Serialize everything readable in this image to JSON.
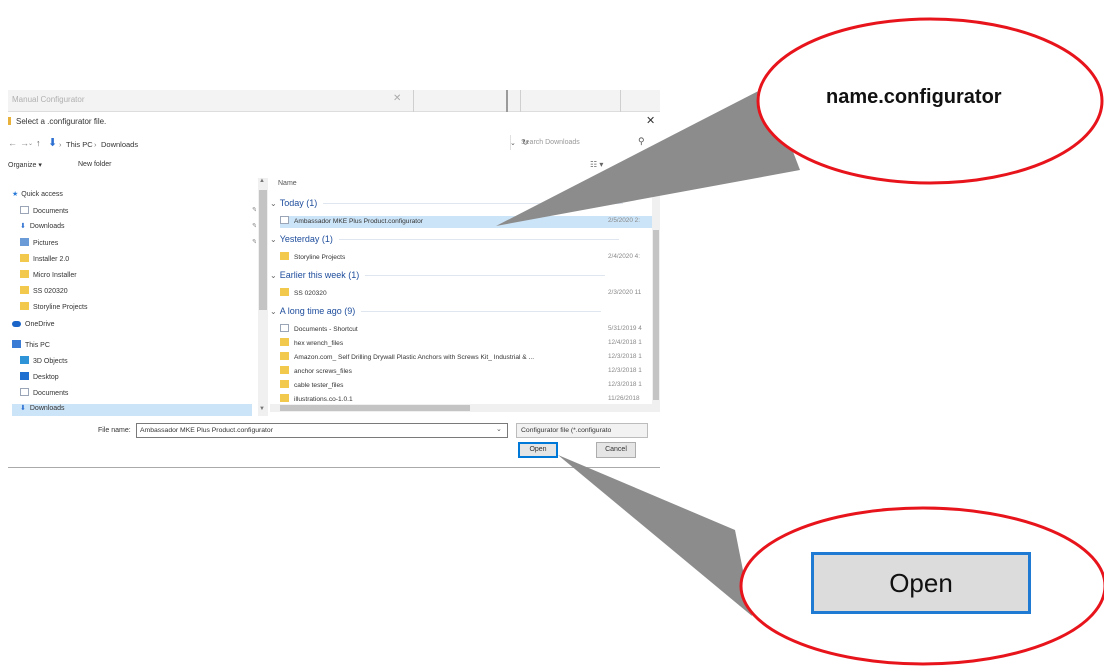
{
  "background_window": {
    "title": "Manual Configurator"
  },
  "dialog": {
    "title": "Select a .configurator file.",
    "address": {
      "crumbs": [
        "This PC",
        "Downloads"
      ],
      "search_placeholder": "Search Downloads"
    },
    "command_bar": {
      "organize": "Organize ▾",
      "new_folder": "New folder"
    },
    "nav_pane": {
      "items": [
        {
          "label": "Quick access",
          "icon": "star-icon"
        },
        {
          "label": "Documents",
          "icon": "documents-icon"
        },
        {
          "label": "Downloads",
          "icon": "download-arrow-icon"
        },
        {
          "label": "Pictures",
          "icon": "pictures-icon"
        },
        {
          "label": "Installer 2.0",
          "icon": "folder-icon"
        },
        {
          "label": "Micro Installer",
          "icon": "folder-icon"
        },
        {
          "label": "SS 020320",
          "icon": "folder-icon"
        },
        {
          "label": "Storyline Projects",
          "icon": "folder-icon"
        },
        {
          "label": "OneDrive",
          "icon": "cloud-icon"
        },
        {
          "label": "This PC",
          "icon": "pc-icon"
        },
        {
          "label": "3D Objects",
          "icon": "3d-objects-icon"
        },
        {
          "label": "Desktop",
          "icon": "desktop-icon"
        },
        {
          "label": "Documents",
          "icon": "documents-icon"
        },
        {
          "label": "Downloads",
          "icon": "download-arrow-icon"
        }
      ]
    },
    "file_pane": {
      "column_header": "Name",
      "groups": [
        {
          "label": "Today (1)"
        },
        {
          "label": "Yesterday (1)"
        },
        {
          "label": "Earlier this week (1)"
        },
        {
          "label": "A long time ago (9)"
        }
      ],
      "files": [
        {
          "name": "Ambassador MKE Plus Product.configurator",
          "date": "2/5/2020 2:",
          "selected": true
        },
        {
          "name": "Storyline Projects",
          "date": "2/4/2020 4:"
        },
        {
          "name": "SS 020320",
          "date": "2/3/2020 11"
        },
        {
          "name": "Documents - Shortcut",
          "date": "5/31/2019 4"
        },
        {
          "name": "hex wrench_files",
          "date": "12/4/2018 1"
        },
        {
          "name": "Amazon.com_ Self Drilling Drywall Plastic Anchors with Screws Kit_ Industrial & ...",
          "date": "12/3/2018 1"
        },
        {
          "name": "anchor screws_files",
          "date": "12/3/2018 1"
        },
        {
          "name": "cable tester_files",
          "date": "12/3/2018 1"
        },
        {
          "name": "illustrations.co-1.0.1",
          "date": "11/26/2018"
        }
      ]
    },
    "bottom": {
      "file_name_label": "File name:",
      "file_name_value": "Ambassador MKE Plus Product.configurator",
      "filter": "Configurator file (*.configurato",
      "open_label": "Open",
      "cancel_label": "Cancel"
    }
  },
  "callouts": {
    "top_label": "name.configurator",
    "bottom_label": "Open",
    "ring_color": "#e8141c",
    "arrow_color": "#8c8c8c"
  }
}
